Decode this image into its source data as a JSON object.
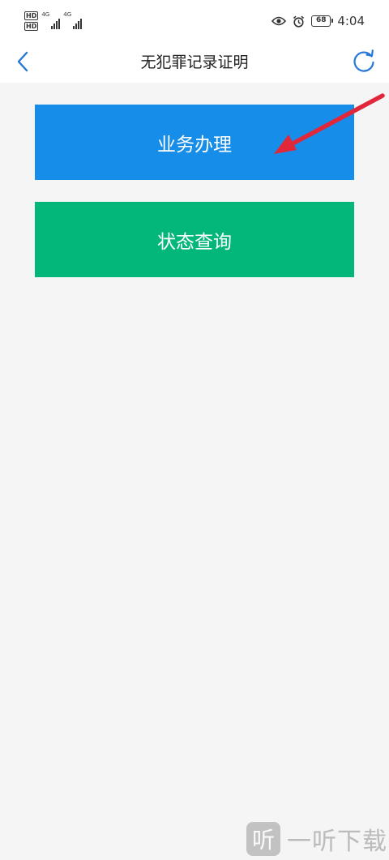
{
  "status_bar": {
    "hd_badges": [
      "HD",
      "HD"
    ],
    "network_labels": [
      "4G",
      "4G"
    ],
    "eye_icon": "eye-icon",
    "alarm_icon": "alarm-clock-icon",
    "battery_level": "68",
    "time": "4:04"
  },
  "nav": {
    "back_icon": "chevron-left-icon",
    "title": "无犯罪记录证明",
    "refresh_icon": "refresh-icon"
  },
  "buttons": {
    "business": "业务办理",
    "status": "状态查询"
  },
  "colors": {
    "business_button": "#168de8",
    "status_button": "#03b77a",
    "annotation_arrow": "#e0283a",
    "nav_icon": "#2577d8"
  },
  "watermark": {
    "icon_text": "听",
    "text": "一听下载"
  }
}
